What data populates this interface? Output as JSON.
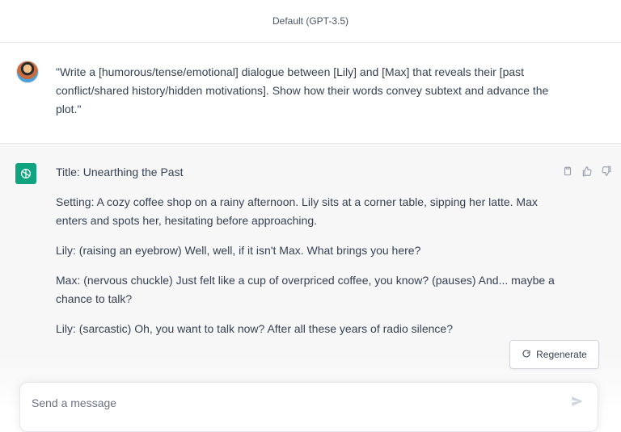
{
  "header": {
    "model_label": "Default (GPT-3.5)"
  },
  "user_message": {
    "text": "\"Write a [humorous/tense/emotional] dialogue between [Lily] and [Max] that reveals their [past conflict/shared history/hidden motivations]. Show how their words convey subtext and advance the plot.\""
  },
  "assistant_message": {
    "paragraphs": [
      "Title: Unearthing the Past",
      "Setting: A cozy coffee shop on a rainy afternoon. Lily sits at a corner table, sipping her latte. Max enters and spots her, hesitating before approaching.",
      "Lily: (raising an eyebrow) Well, well, if it isn't Max. What brings you here?",
      "Max: (nervous chuckle) Just felt like a cup of overpriced coffee, you know? (pauses) And... maybe a chance to talk?",
      "Lily: (sarcastic) Oh, you want to talk now? After all these years of radio silence?"
    ],
    "icons": [
      "clipboard-icon",
      "thumbs-up-icon",
      "thumbs-down-icon"
    ]
  },
  "regenerate": {
    "label": "Regenerate",
    "icon": "refresh-icon"
  },
  "composer": {
    "placeholder": "Send a message",
    "send_icon": "send-icon"
  },
  "colors": {
    "accent": "#10a37f",
    "assistant_bg": "#f7f7f8",
    "text": "#374151"
  }
}
